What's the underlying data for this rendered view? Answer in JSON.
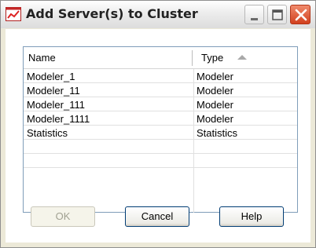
{
  "window": {
    "title": "Add Server(s) to Cluster",
    "icon": "chart-line-icon"
  },
  "table": {
    "columns": [
      {
        "label": "Name"
      },
      {
        "label": "Type",
        "sort": "ascending"
      }
    ],
    "rows": [
      {
        "name": "Modeler_1",
        "type": "Modeler"
      },
      {
        "name": "Modeler_11",
        "type": "Modeler"
      },
      {
        "name": "Modeler_111",
        "type": "Modeler"
      },
      {
        "name": "Modeler_1111",
        "type": "Modeler"
      },
      {
        "name": "Statistics",
        "type": "Statistics"
      },
      {
        "name": "",
        "type": ""
      },
      {
        "name": "",
        "type": ""
      }
    ]
  },
  "buttons": {
    "ok_label": "OK",
    "ok_enabled": false,
    "cancel_label": "Cancel",
    "help_label": "Help"
  },
  "colors": {
    "window_bg": "#ece9d8",
    "border": "#7f9db9",
    "close_button": "#d2401d"
  }
}
